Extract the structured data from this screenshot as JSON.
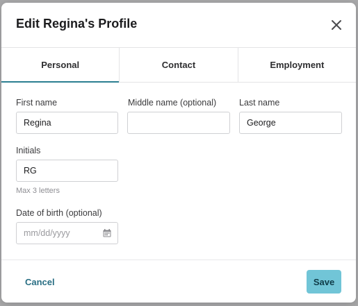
{
  "modal": {
    "title": "Edit Regina's Profile"
  },
  "tabs": [
    {
      "label": "Personal",
      "active": true
    },
    {
      "label": "Contact",
      "active": false
    },
    {
      "label": "Employment",
      "active": false
    }
  ],
  "form": {
    "first_name": {
      "label": "First name",
      "value": "Regina"
    },
    "middle_name": {
      "label": "Middle name (optional)",
      "value": ""
    },
    "last_name": {
      "label": "Last name",
      "value": "George"
    },
    "initials": {
      "label": "Initials",
      "value": "RG",
      "hint": "Max 3 letters"
    },
    "dob": {
      "label": "Date of birth (optional)",
      "placeholder": "mm/dd/yyyy"
    }
  },
  "footer": {
    "cancel_label": "Cancel",
    "save_label": "Save"
  },
  "colors": {
    "accent": "#2b7e90",
    "save_bg": "#71c5d7",
    "cancel_text": "#2a6f84"
  },
  "icons": {
    "close": "close-icon",
    "calendar": "calendar-icon"
  }
}
